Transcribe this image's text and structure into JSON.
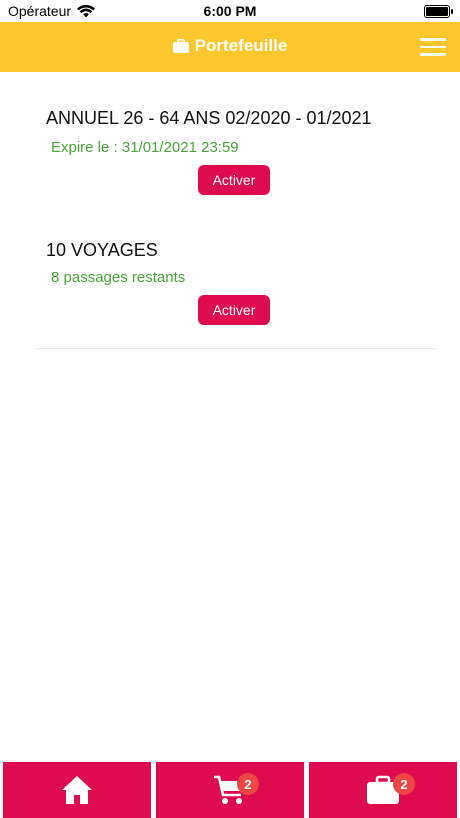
{
  "status_bar": {
    "carrier": "Opérateur",
    "time": "6:00 PM"
  },
  "header": {
    "title": "Portefeuille",
    "icon": "wallet-icon"
  },
  "tickets": [
    {
      "title": "ANNUEL 26 - 64 ANS 02/2020 - 01/2021",
      "subtitle": "Expire le : 31/01/2021 23:59",
      "button": "Activer"
    },
    {
      "title": "10 VOYAGES",
      "subtitle": "8 passages restants",
      "button": "Activer"
    }
  ],
  "bottom_nav": [
    {
      "icon": "home-icon"
    },
    {
      "icon": "cart-icon",
      "badge": "2"
    },
    {
      "icon": "wallet-icon",
      "badge": "2"
    }
  ],
  "colors": {
    "header": "#fdc72d",
    "accent": "#df0b4f",
    "success": "#4aa43b",
    "badge": "#f04545"
  }
}
